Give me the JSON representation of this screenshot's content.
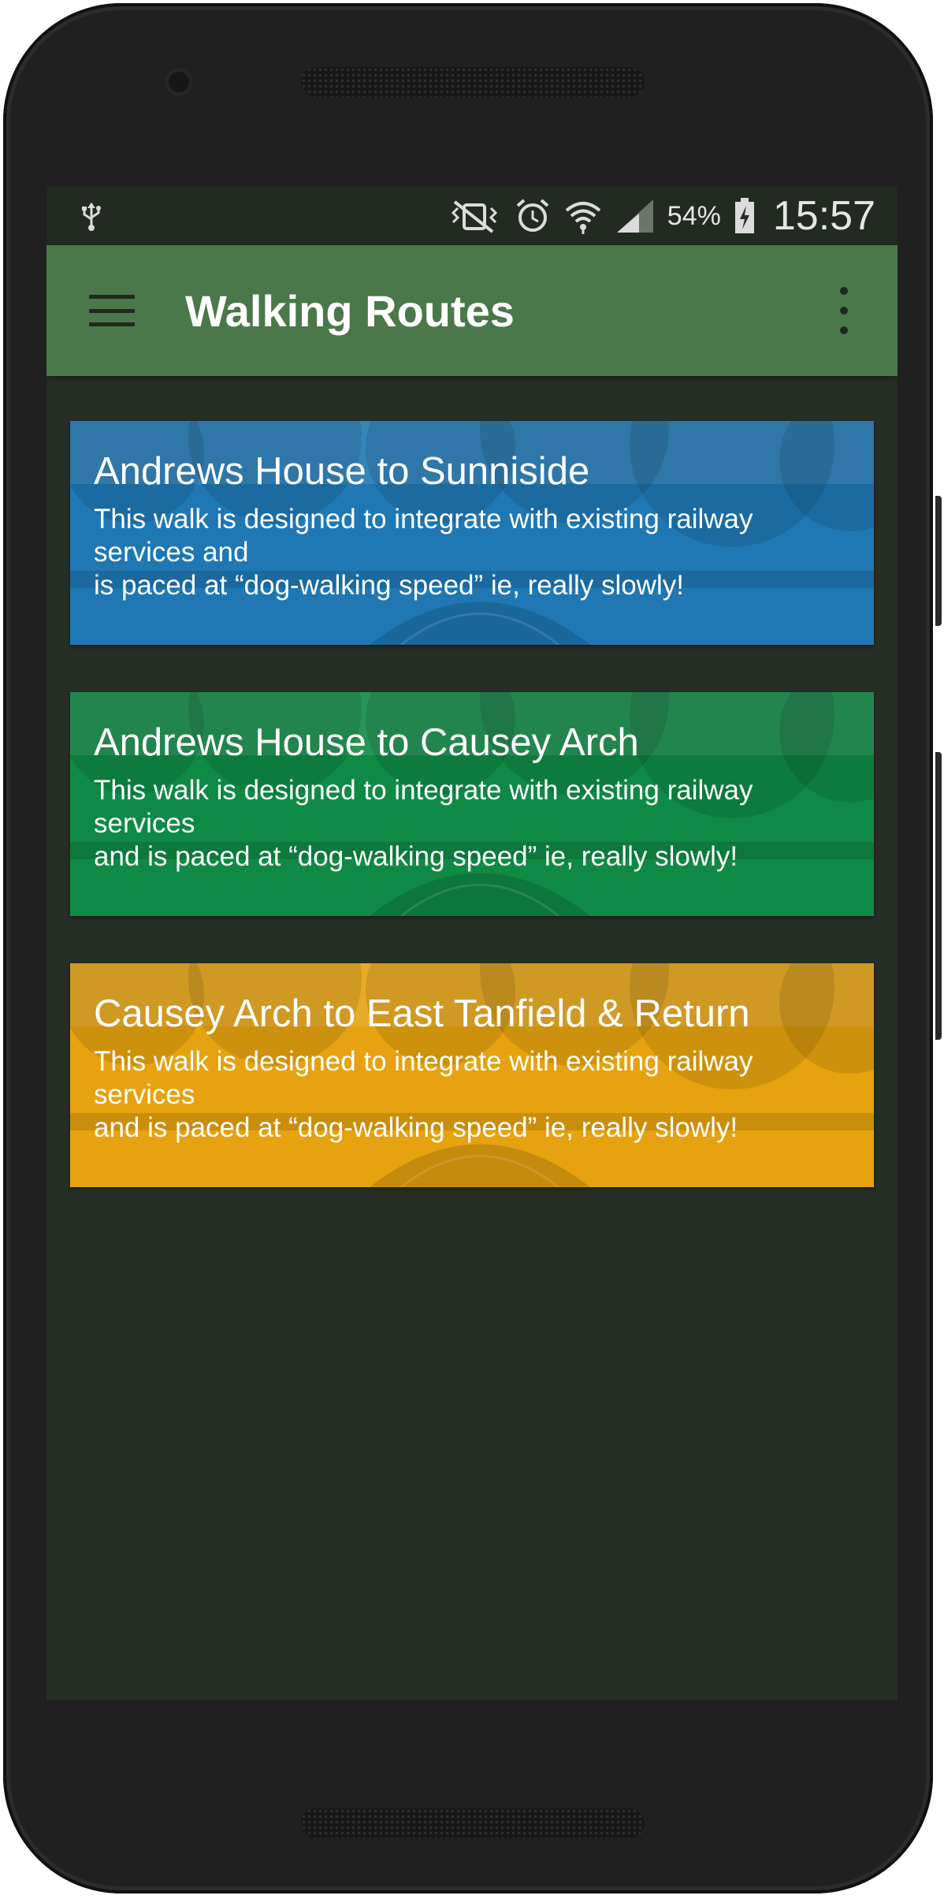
{
  "status_bar": {
    "battery_percent": "54%",
    "time": "15:57",
    "icons": [
      "usb-icon",
      "vibrate-icon",
      "alarm-icon",
      "wifi-icon",
      "cell-signal-icon",
      "battery-icon"
    ]
  },
  "app_bar": {
    "title": "Walking Routes",
    "menu_icon": "hamburger-menu-icon",
    "overflow_icon": "more-vert-icon"
  },
  "routes": [
    {
      "title": "Andrews House to Sunniside",
      "description": "This walk is designed to integrate with existing railway services and\nis paced at “dog-walking speed” ie, really slowly!",
      "color": "#1f78b4"
    },
    {
      "title": "Andrews House to Causey Arch",
      "description": "This walk is designed to integrate with existing railway services\nand is paced at “dog-walking speed” ie, really slowly!",
      "color": "#0f8a45"
    },
    {
      "title": "Causey Arch to East Tanfield & Return",
      "description": "This walk is designed to integrate with existing railway services\nand is paced at “dog-walking speed” ie, really slowly!",
      "color": "#e6a20f"
    }
  ],
  "colors": {
    "app_bar": "#4a784a",
    "background": "#262e26",
    "status_bar": "#222a22"
  }
}
